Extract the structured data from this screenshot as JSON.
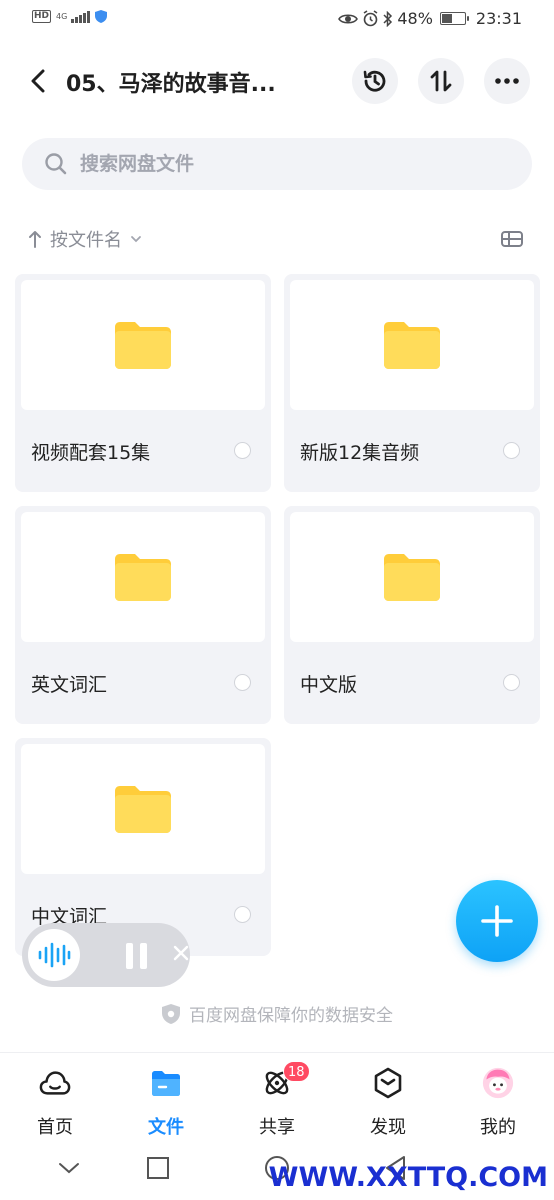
{
  "status_bar": {
    "hd": "HD",
    "network": "4G",
    "battery_text": "48%",
    "battery_level": 0.48,
    "time": "23:31"
  },
  "header": {
    "title": "05、马泽的故事音...",
    "icons": [
      "back-arrow-icon",
      "history-icon",
      "sort-swap-icon",
      "more-icon"
    ]
  },
  "search": {
    "placeholder": "搜索网盘文件",
    "value": ""
  },
  "sort": {
    "label": "按文件名"
  },
  "folders": [
    {
      "name": "视频配套15集"
    },
    {
      "name": "新版12集音频"
    },
    {
      "name": "英文词汇"
    },
    {
      "name": "中文版"
    },
    {
      "name": "中文词汇"
    }
  ],
  "security_note": "百度网盘保障你的数据安全",
  "tabs": [
    {
      "label": "首页",
      "icon": "cloud-home-icon"
    },
    {
      "label": "文件",
      "icon": "folder-icon",
      "active": true
    },
    {
      "label": "共享",
      "icon": "share-atom-icon",
      "badge": "18"
    },
    {
      "label": "发现",
      "icon": "discover-box-icon"
    },
    {
      "label": "我的",
      "icon": "avatar-icon"
    }
  ],
  "watermark": "WWW.XXTTQ.COM",
  "colors": {
    "accent": "#1a8cff",
    "folder": "#ffd64a",
    "fab": "#12a9f8",
    "badge": "#ff4a62"
  }
}
